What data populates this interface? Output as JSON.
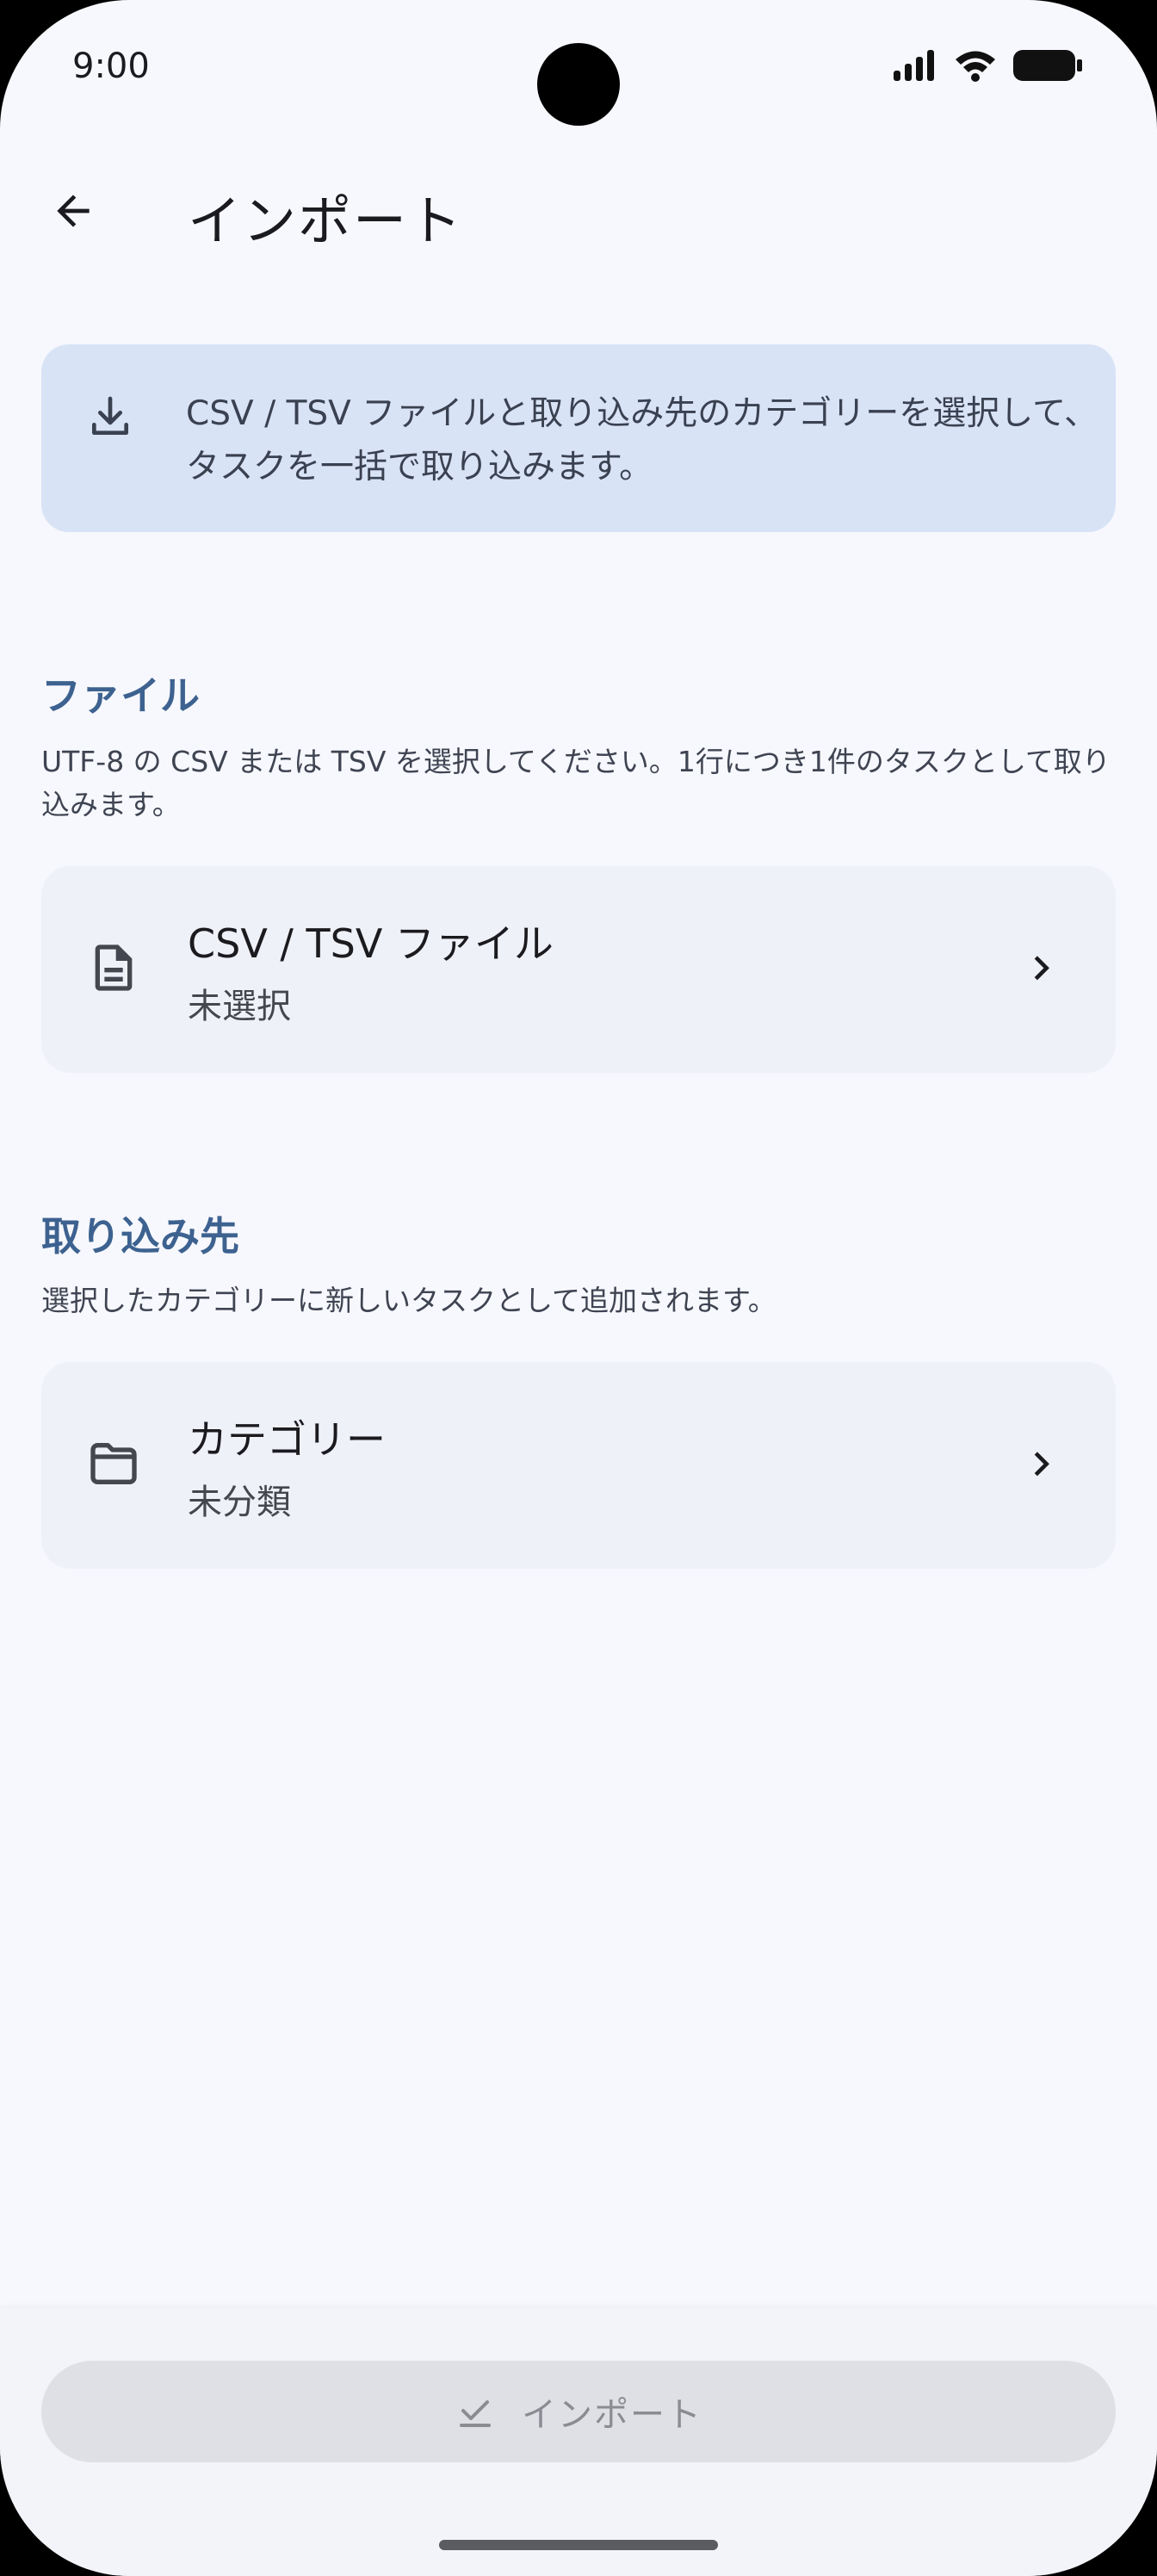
{
  "status_bar": {
    "time": "9:00",
    "icons": [
      "signal-icon",
      "wifi-icon",
      "battery-icon"
    ]
  },
  "app_bar": {
    "back_icon": "arrow-back-icon",
    "title": "インポート"
  },
  "banner": {
    "icon": "download-icon",
    "text": "CSV / TSV ファイルと取り込み先のカテゴリーを選択して、タスクを一括で取り込みます。"
  },
  "file_section": {
    "title": "ファイル",
    "description": "UTF-8 の CSV または TSV を選択してください。1行につき1件のタスクとして取り込みます。",
    "card": {
      "icon": "document-icon",
      "title": "CSV / TSV ファイル",
      "value": "未選択",
      "chevron": "chevron-right-icon"
    }
  },
  "destination_section": {
    "title": "取り込み先",
    "description": "選択したカテゴリーに新しいタスクとして追加されます。",
    "card": {
      "icon": "folder-icon",
      "title": "カテゴリー",
      "value": "未分類",
      "chevron": "chevron-right-icon"
    }
  },
  "import_button": {
    "icon": "check-icon",
    "label": "インポート",
    "enabled": false
  },
  "colors": {
    "background": "#f7f8fd",
    "banner": "#d8e3f6",
    "accent": "#3d6290",
    "card": "#eff1f8",
    "disabled_button": "#dfe0e5"
  }
}
